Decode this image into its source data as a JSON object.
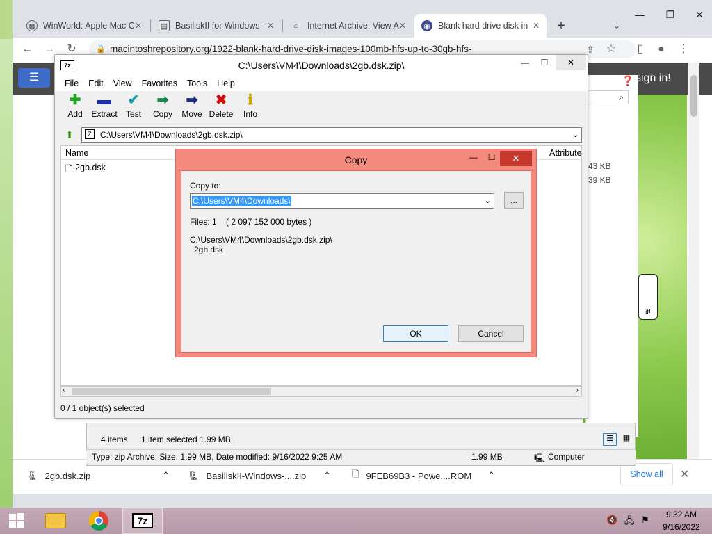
{
  "browser": {
    "tabs": [
      {
        "title": "WinWorld: Apple Mac C",
        "icon": "globe-icon"
      },
      {
        "title": "BasiliskII for Windows -",
        "icon": "page-icon"
      },
      {
        "title": "Internet Archive: View A",
        "icon": "archive-icon"
      },
      {
        "title": "Blank hard drive disk in",
        "icon": "globe-icon"
      }
    ],
    "new_tab": "+",
    "url": "macintoshrepository.org/1922-blank-hard-drive-disk-images-100mb-hfs-up-to-30gb-hfs-",
    "page_signin": "sign in!",
    "page_bubble": "it!"
  },
  "downloads": {
    "items": [
      "2gb.dsk.zip",
      "BasiliskII-Windows-....zip",
      "9FEB69B3 - Powe....ROM"
    ],
    "show_all": "Show all"
  },
  "sevenzip": {
    "title": "C:\\Users\\VM4\\Downloads\\2gb.dsk.zip\\",
    "logo": "7z",
    "menu": [
      "File",
      "Edit",
      "View",
      "Favorites",
      "Tools",
      "Help"
    ],
    "tools": [
      {
        "label": "Add",
        "icon": "add-icon",
        "glyph": "+",
        "color": "#1fa51f"
      },
      {
        "label": "Extract",
        "icon": "extract-icon",
        "glyph": "−",
        "color": "#1a2fa8"
      },
      {
        "label": "Test",
        "icon": "test-icon",
        "glyph": "✔",
        "color": "#1aa0a8"
      },
      {
        "label": "Copy",
        "icon": "copy-icon",
        "glyph": "➡",
        "color": "#1a8a4a"
      },
      {
        "label": "Move",
        "icon": "move-icon",
        "glyph": "➡",
        "color": "#1a2f80"
      },
      {
        "label": "Delete",
        "icon": "delete-icon",
        "glyph": "✖",
        "color": "#d01010"
      },
      {
        "label": "Info",
        "icon": "info-icon",
        "glyph": "i",
        "color": "#c8a800"
      }
    ],
    "address": "C:\\Users\\VM4\\Downloads\\2gb.dsk.zip\\",
    "columns": {
      "name": "Name",
      "attributes": "Attribute"
    },
    "file": "2gb.dsk",
    "right_sizes": [
      "43 KB",
      "39 KB"
    ],
    "status": "0 / 1 object(s) selected"
  },
  "explorer": {
    "items_count": "4 items",
    "selected": "1 item selected  1.99 MB",
    "details": "Type: zip Archive, Size: 1.99 MB, Date modified: 9/16/2022 9:25 AM",
    "size": "1.99 MB",
    "location": "Computer"
  },
  "copy_dialog": {
    "title": "Copy",
    "copy_to_label": "Copy to:",
    "path": "C:\\Users\\VM4\\Downloads\\",
    "browse": "...",
    "files_line": "Files: 1    ( 2 097 152 000 bytes )",
    "source_path": "C:\\Users\\VM4\\Downloads\\2gb.dsk.zip\\",
    "source_file": "2gb.dsk",
    "ok": "OK",
    "cancel": "Cancel"
  },
  "taskbar": {
    "time": "9:32 AM",
    "date": "9/16/2022",
    "apps": [
      "file-explorer-icon",
      "chrome-icon",
      "7zip-icon"
    ]
  },
  "colors": {
    "dialog_frame": "#f58a7e",
    "selection": "#3399ff",
    "taskbar": "#b79aa9"
  }
}
